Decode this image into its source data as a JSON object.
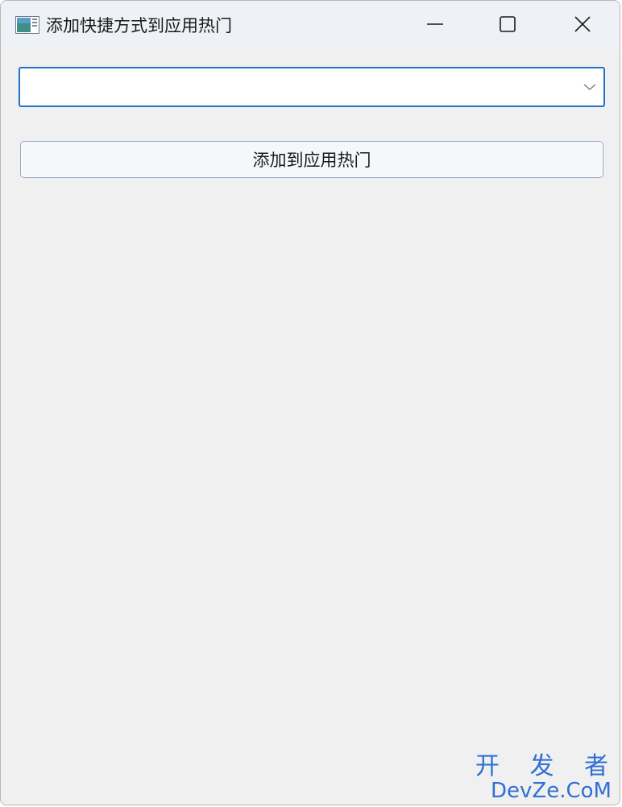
{
  "window": {
    "title": "添加快捷方式到应用热门"
  },
  "form": {
    "combo_value": "",
    "add_button_label": "添加到应用热门"
  },
  "watermark": {
    "line1": "开 发 者",
    "line2": "DevZe.CoM"
  },
  "colors": {
    "accent": "#1f74c9",
    "background": "#f0f0f0",
    "watermark": "#2f6fd6"
  },
  "icons": {
    "app": "app-window-icon",
    "minimize": "minimize-icon",
    "maximize": "maximize-icon",
    "close": "close-icon",
    "dropdown": "chevron-down-icon"
  }
}
